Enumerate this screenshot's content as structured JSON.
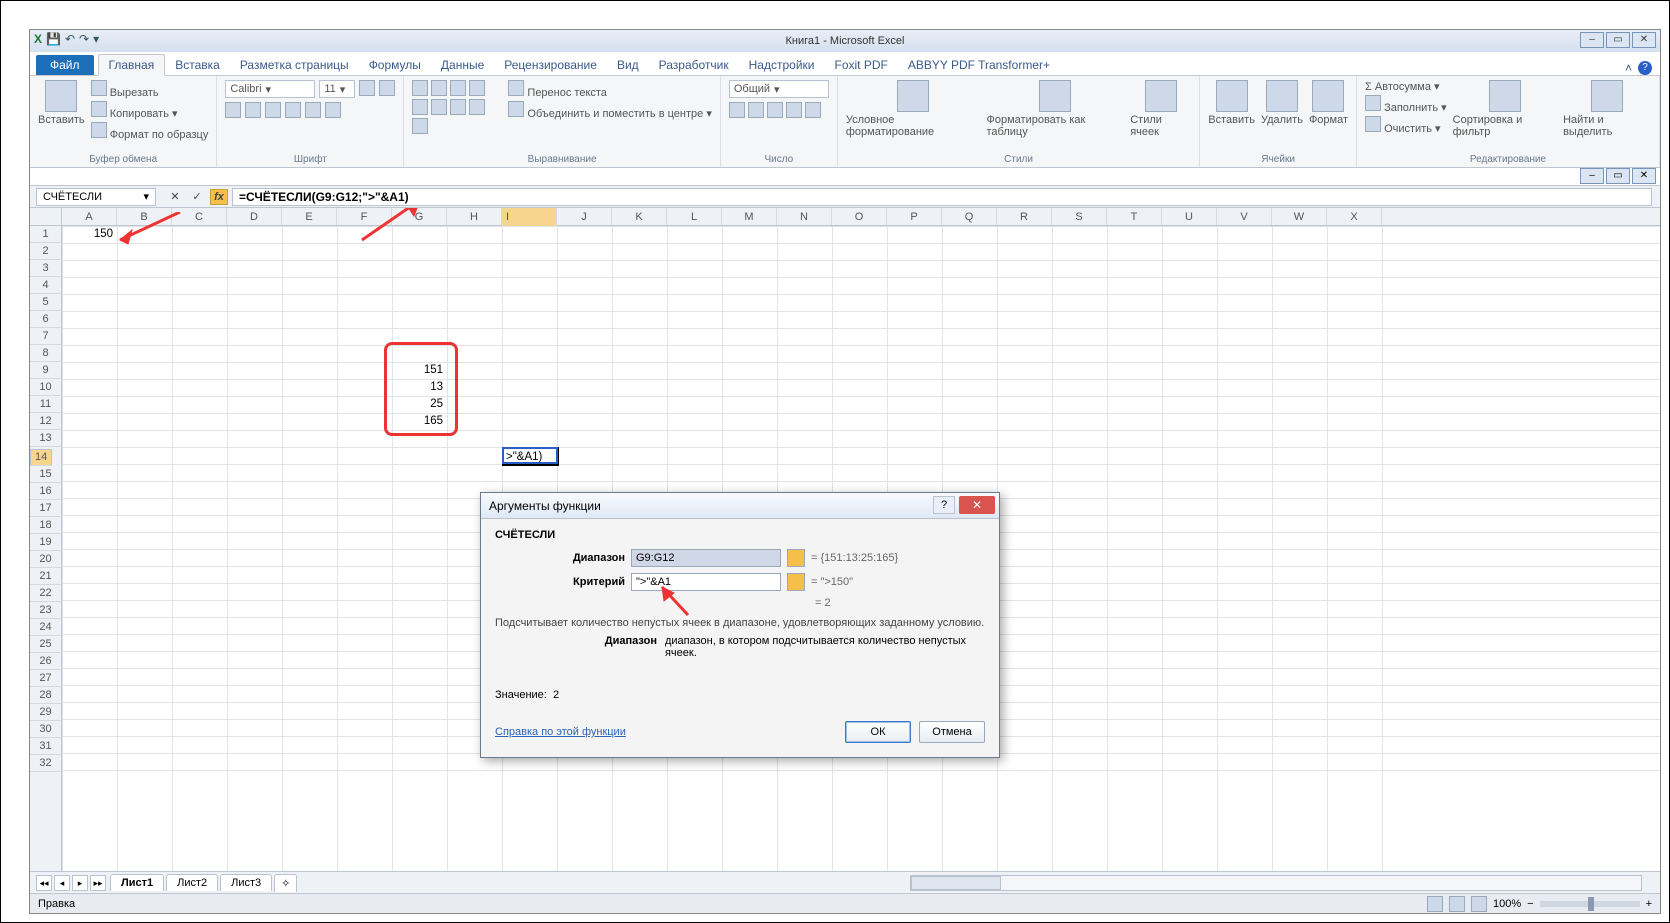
{
  "window": {
    "title": "Книга1 - Microsoft Excel"
  },
  "qat": {
    "save": "save-icon",
    "undo": "undo-icon",
    "redo": "redo-icon"
  },
  "wincontrols": {
    "min": "–",
    "max": "▭",
    "close": "✕",
    "min2": "–",
    "max2": "▭",
    "close2": "✕"
  },
  "tabs": {
    "file": "Файл",
    "items": [
      "Главная",
      "Вставка",
      "Разметка страницы",
      "Формулы",
      "Данные",
      "Рецензирование",
      "Вид",
      "Разработчик",
      "Надстройки",
      "Foxit PDF",
      "ABBYY PDF Transformer+"
    ],
    "active": 0
  },
  "help": {
    "collapse": "^",
    "help": "?"
  },
  "ribbon": {
    "clipboard": {
      "label": "Буфер обмена",
      "paste": "Вставить",
      "cut": "Вырезать",
      "copy": "Копировать",
      "format": "Формат по образцу"
    },
    "font": {
      "label": "Шрифт",
      "name": "Calibri",
      "size": "11"
    },
    "align": {
      "label": "Выравнивание",
      "wrap": "Перенос текста",
      "merge": "Объединить и поместить в центре"
    },
    "number": {
      "label": "Число",
      "format": "Общий"
    },
    "styles": {
      "label": "Стили",
      "cond": "Условное форматирование",
      "table": "Форматировать как таблицу",
      "cell": "Стили ячеек"
    },
    "cells": {
      "label": "Ячейки",
      "insert": "Вставить",
      "delete": "Удалить",
      "format": "Формат"
    },
    "editing": {
      "label": "Редактирование",
      "sum": "Автосумма",
      "fill": "Заполнить",
      "clear": "Очистить",
      "sort": "Сортировка и фильтр",
      "find": "Найти и выделить"
    }
  },
  "namebox": "СЧЁТЕСЛИ",
  "formula": "=СЧЁТЕСЛИ(G9:G12;\">\"&A1)",
  "columns": [
    "A",
    "B",
    "C",
    "D",
    "E",
    "F",
    "G",
    "H",
    "I",
    "J",
    "K",
    "L",
    "M",
    "N",
    "O",
    "P",
    "Q",
    "R",
    "S",
    "T",
    "U",
    "V",
    "W",
    "X"
  ],
  "rows_count": 32,
  "active_col": "I",
  "active_row": 14,
  "cell_data": {
    "A1": "150",
    "G9": "151",
    "G10": "13",
    "G11": "25",
    "G12": "165",
    "I14_editing": ">\"&A1)"
  },
  "dialog": {
    "title": "Аргументы функции",
    "func": "СЧЁТЕСЛИ",
    "arg1": {
      "label": "Диапазон",
      "value": "G9:G12",
      "result": "= {151:13:25:165}"
    },
    "arg2": {
      "label": "Критерий",
      "value": "\">\"&A1",
      "result": "= \">150\""
    },
    "result": "= 2",
    "desc": "Подсчитывает количество непустых ячеек в диапазоне, удовлетворяющих заданному условию.",
    "arg_help_label": "Диапазон",
    "arg_help": "диапазон, в котором подсчитывается количество непустых ячеек.",
    "value_label": "Значение:",
    "value": "2",
    "help_link": "Справка по этой функции",
    "ok": "ОК",
    "cancel": "Отмена"
  },
  "sheets": {
    "items": [
      "Лист1",
      "Лист2",
      "Лист3"
    ],
    "active": 0
  },
  "status": {
    "mode": "Правка",
    "zoom": "100%"
  }
}
